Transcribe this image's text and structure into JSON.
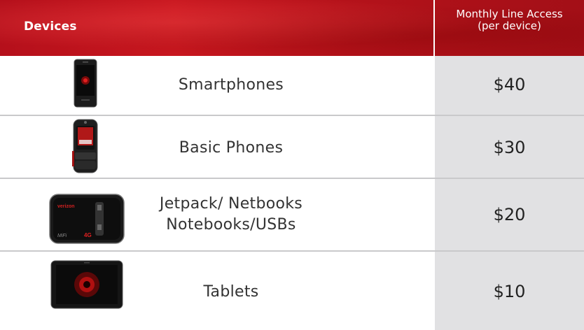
{
  "header": {
    "devices_label": "Devices",
    "monthly_line1": "Monthly Line Access",
    "monthly_line2": "(per device)",
    "background_color": "#c0141d"
  },
  "rows": [
    {
      "label_lines": [
        "Smartphones"
      ],
      "price": "$40",
      "icon": "smartphone-icon"
    },
    {
      "label_lines": [
        "Basic Phones"
      ],
      "price": "$30",
      "icon": "flip-phone-icon"
    },
    {
      "label_lines": [
        "Jetpack/ Netbooks",
        "Notebooks/USBs"
      ],
      "price": "$20",
      "icon": "mifi-hotspot-icon"
    },
    {
      "label_lines": [
        "Tablets"
      ],
      "price": "$10",
      "icon": "tablet-icon"
    }
  ],
  "price_column_color": "#e1e1e3"
}
